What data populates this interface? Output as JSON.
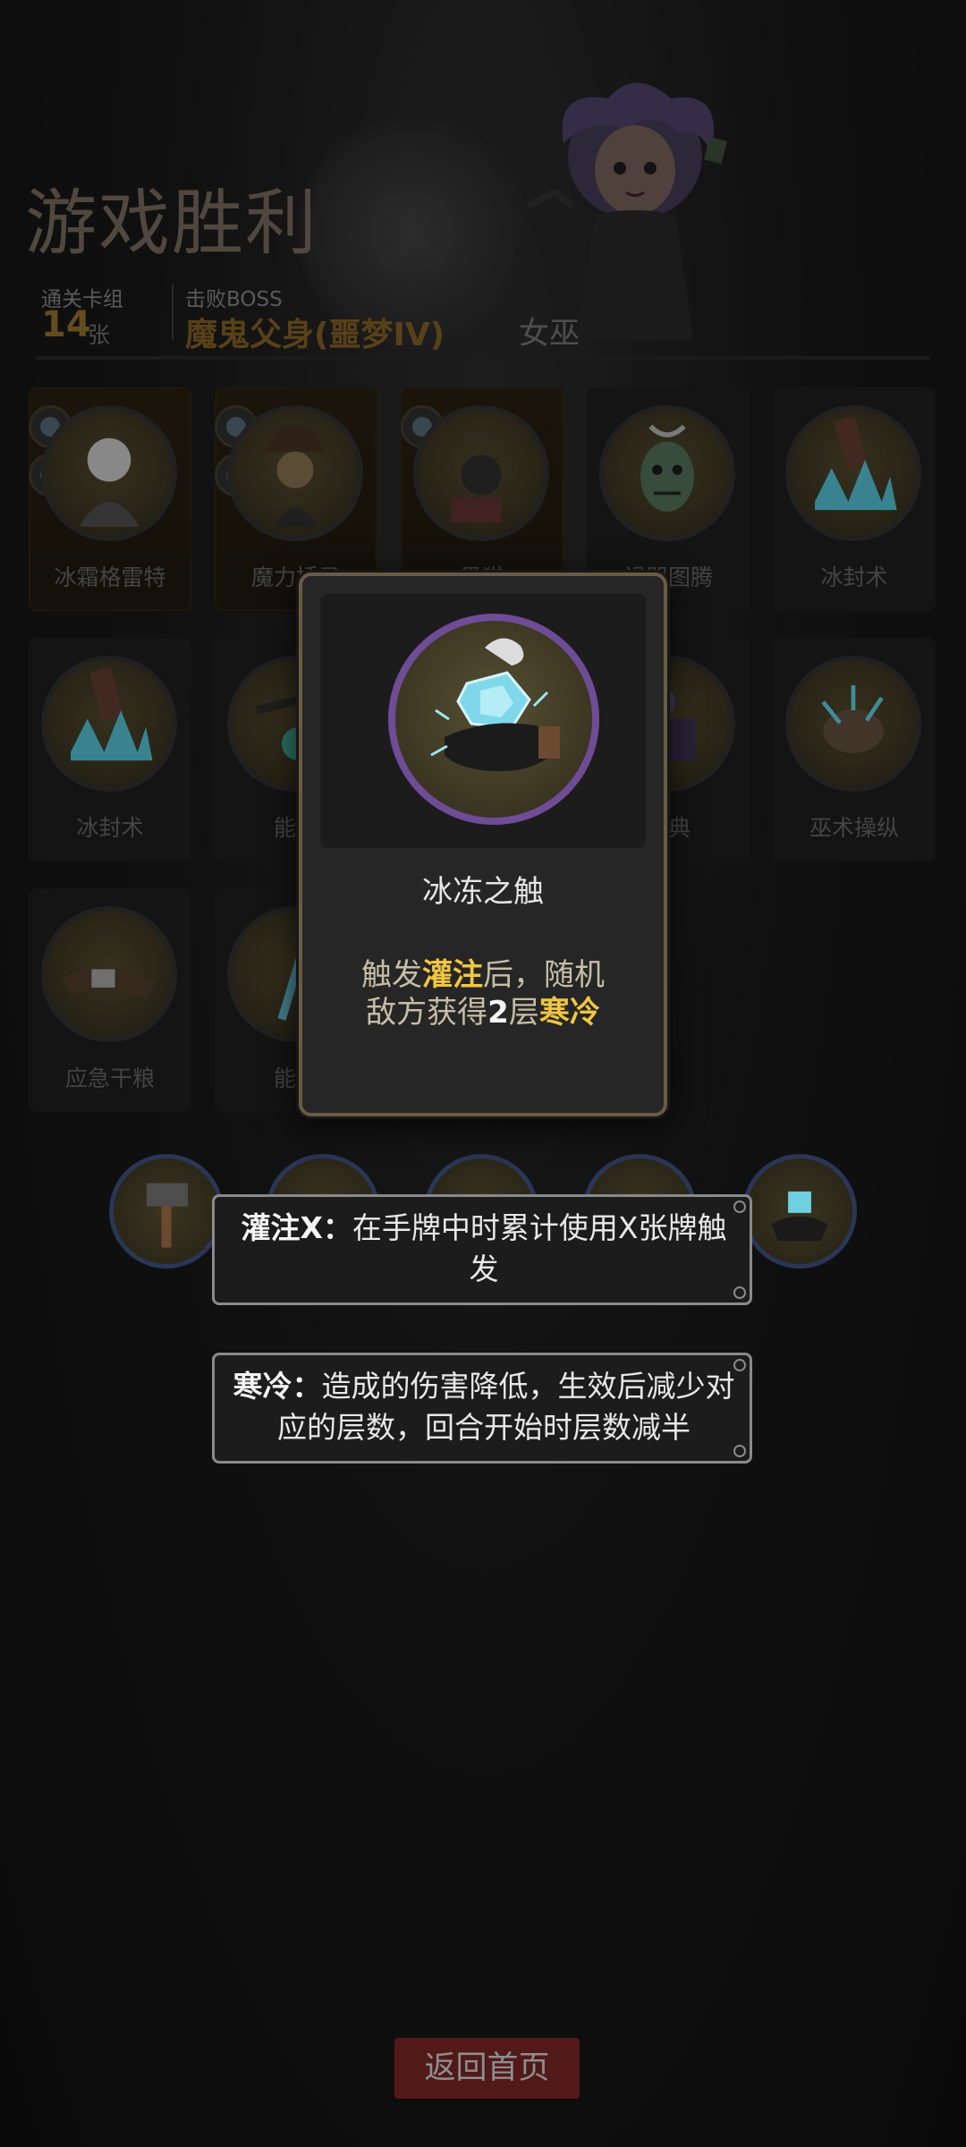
{
  "header": {
    "title": "游戏胜利",
    "deck_label": "通关卡组",
    "deck_count": "14",
    "deck_unit": "张",
    "boss_label": "击败BOSS",
    "boss_name": "魔鬼父身(噩梦IV)",
    "character": "女巫"
  },
  "cards": [
    {
      "label": "冰霜格雷特",
      "variant": "gold"
    },
    {
      "label": "魔力插录",
      "variant": "gold"
    },
    {
      "label": "黑猫",
      "variant": "gold"
    },
    {
      "label": "诅咒图腾",
      "variant": "normal"
    },
    {
      "label": "冰封术",
      "variant": "normal"
    },
    {
      "label": "冰封术",
      "variant": "normal"
    },
    {
      "label": "能量",
      "variant": "normal"
    },
    {
      "label": "",
      "variant": "normal"
    },
    {
      "label": "魔典",
      "variant": "normal"
    },
    {
      "label": "巫术操纵",
      "variant": "normal"
    },
    {
      "label": "应急干粮",
      "variant": "normal"
    },
    {
      "label": "能量",
      "variant": "normal"
    }
  ],
  "popup": {
    "card_name": "冰冻之触",
    "desc_line1_pre": "触发",
    "desc_line1_kw": "灌注",
    "desc_line1_post": "后，随机",
    "desc_line2_pre": "敌方获得",
    "desc_line2_num": "2",
    "desc_line2_mid": "层",
    "desc_line2_kw": "寒冷"
  },
  "tooltips": {
    "infuse_kw": "灌注X：",
    "infuse_text": "在手牌中时累计使用X张牌触发",
    "cold_kw": "寒冷：",
    "cold_text": "造成的伤害降低，生效后减少对应的层数，回合开始时层数减半"
  },
  "footer": {
    "return_label": "返回首页"
  },
  "colors": {
    "gold_keyword": "#f0c642",
    "popup_border": "#6b5b43",
    "popup_art_ring": "#6f4c96",
    "return_button": "#521919"
  }
}
